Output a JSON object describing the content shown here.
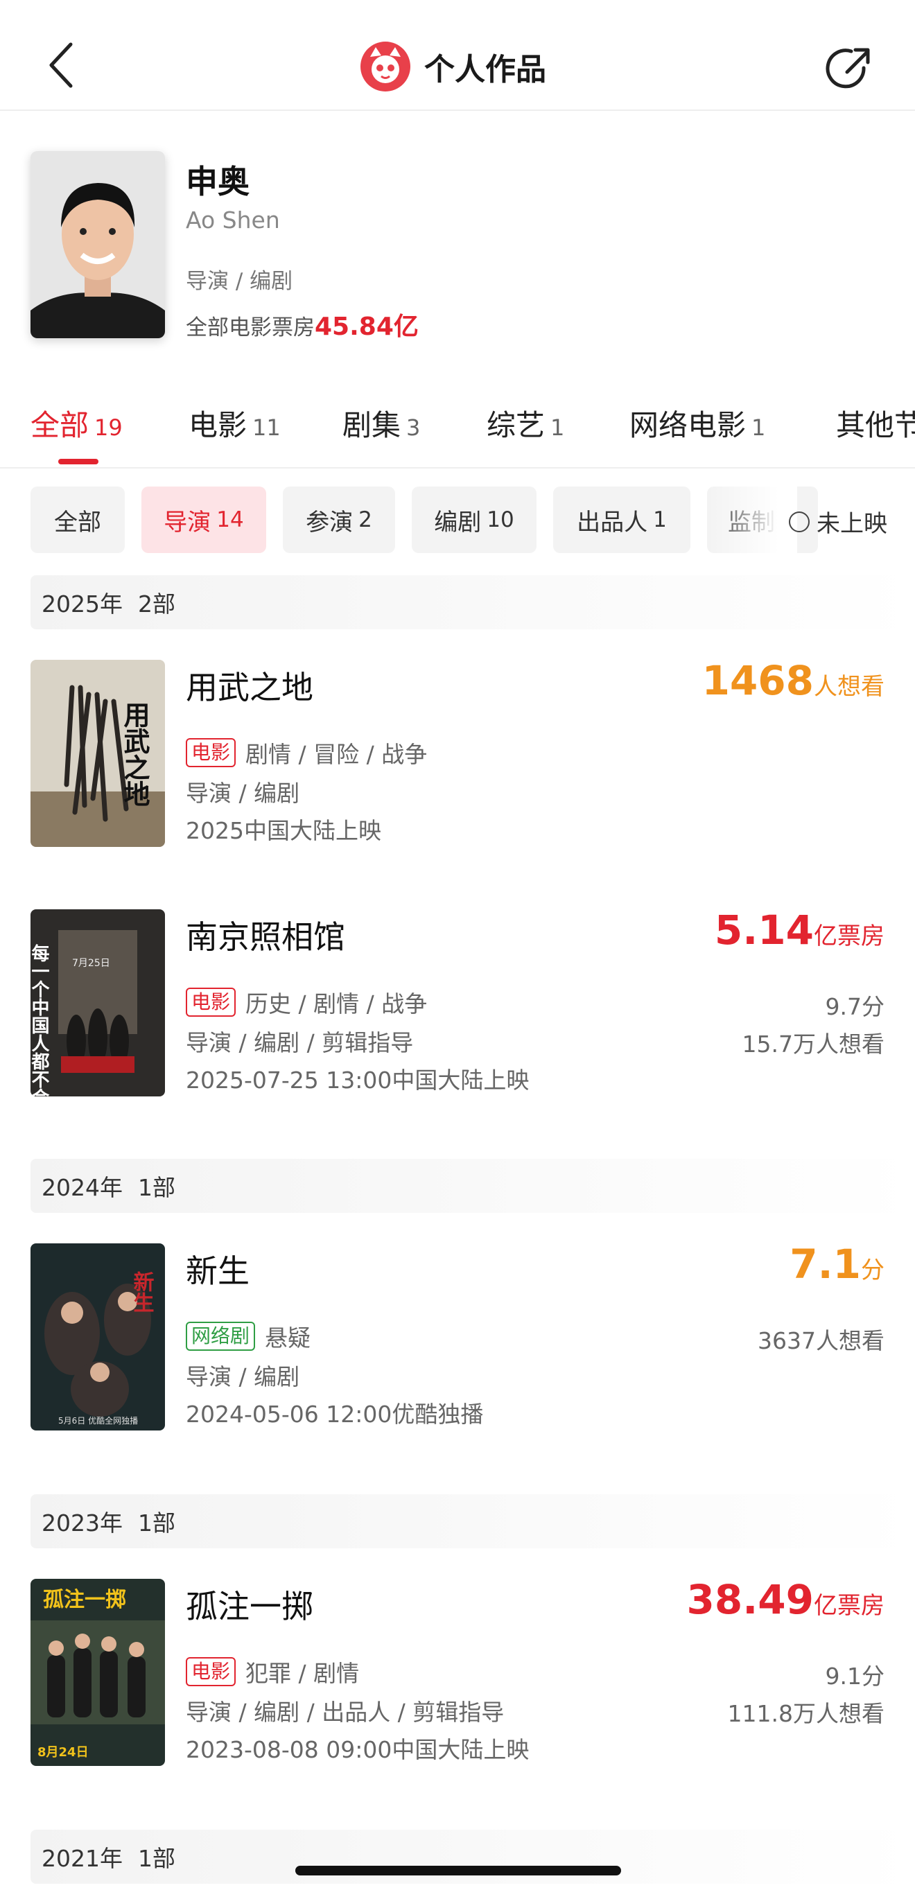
{
  "header": {
    "title": "个人作品",
    "back_icon": "back-arrow-icon",
    "share_icon": "share-icon",
    "logo_icon": "cat-logo-icon"
  },
  "profile": {
    "name_zh": "申奥",
    "name_en": "Ao Shen",
    "roles": "导演 / 编剧",
    "box_label": "全部电影票房",
    "box_value": "45.84亿"
  },
  "tabs": [
    {
      "label": "全部",
      "count": "19"
    },
    {
      "label": "电影",
      "count": "11"
    },
    {
      "label": "剧集",
      "count": "3"
    },
    {
      "label": "综艺",
      "count": "1"
    },
    {
      "label": "网络电影",
      "count": "1"
    },
    {
      "label": "其他节",
      "count": ""
    }
  ],
  "filters": [
    {
      "label": "全部",
      "count": ""
    },
    {
      "label": "导演",
      "count": "14"
    },
    {
      "label": "参演",
      "count": "2"
    },
    {
      "label": "编剧",
      "count": "10"
    },
    {
      "label": "出品人",
      "count": "1"
    },
    {
      "label": "监制",
      "count": ""
    }
  ],
  "unreleased_label": "未上映",
  "years": [
    {
      "year": "2025年",
      "count": "2部"
    },
    {
      "year": "2024年",
      "count": "1部"
    },
    {
      "year": "2023年",
      "count": "1部"
    },
    {
      "year": "2021年",
      "count": "1部"
    }
  ],
  "works": [
    {
      "title": "用武之地",
      "badge": "电影",
      "genres": "剧情 / 冒险 / 战争",
      "roles": "导演 / 编剧",
      "release": "2025中国大陆上映",
      "stat_value": "1468",
      "stat_unit": "人想看",
      "rating": "",
      "want": ""
    },
    {
      "title": "南京照相馆",
      "badge": "电影",
      "genres": "历史 / 剧情 / 战争",
      "roles": "导演 / 编剧 / 剪辑指导",
      "release": "2025-07-25 13:00中国大陆上映",
      "stat_value": "5.14",
      "stat_unit": "亿票房",
      "rating": "9.7分",
      "want": "15.7万人想看"
    },
    {
      "title": "新生",
      "badge": "网络剧",
      "genres": "悬疑",
      "roles": "导演 / 编剧",
      "release": "2024-05-06 12:00优酷独播",
      "stat_value": "7.1",
      "stat_unit": "分",
      "rating": "",
      "want": "3637人想看"
    },
    {
      "title": "孤注一掷",
      "badge": "电影",
      "genres": "犯罪 / 剧情",
      "roles": "导演 / 编剧 / 出品人 / 剪辑指导",
      "release": "2023-08-08 09:00中国大陆上映",
      "stat_value": "38.49",
      "stat_unit": "亿票房",
      "rating": "9.1分",
      "want": "111.8万人想看"
    }
  ],
  "posters": {
    "p1_text": "用武之地",
    "p2_text": "每一个中国人都不会忘记",
    "p2_badge": "7月25日",
    "p3_text": "新生",
    "p3_caption": "5月6日 优酷全网独播",
    "p4_text": "孤注一掷",
    "p4_caption": "8月24日"
  },
  "colors": {
    "accent_red": "#e2242f",
    "accent_orange": "#f0921d",
    "badge_green": "#2f9e44"
  }
}
